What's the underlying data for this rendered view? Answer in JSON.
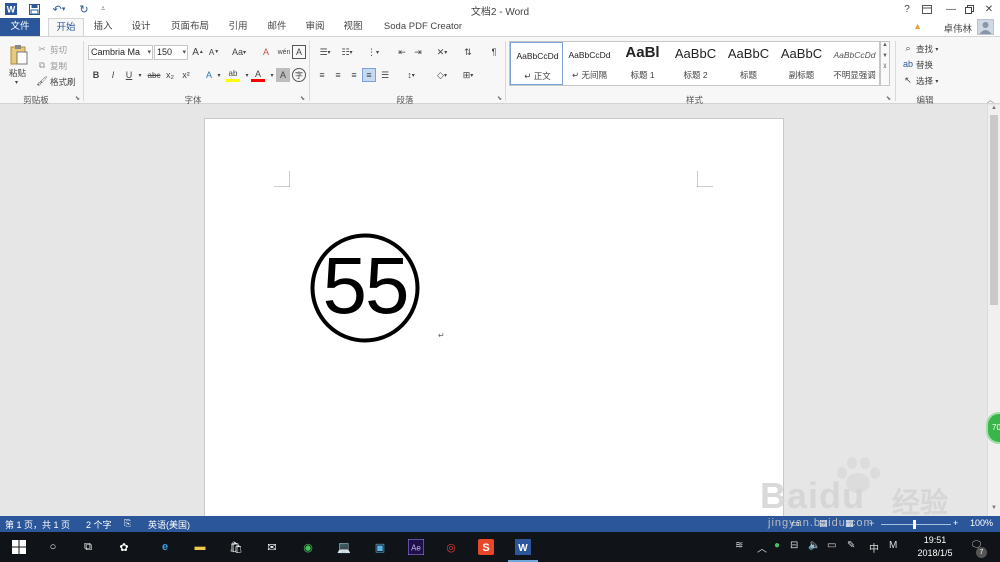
{
  "app": {
    "title": "文档2 - Word",
    "help": "?",
    "user_name": "卓伟林"
  },
  "tabs": [
    "文件",
    "开始",
    "插入",
    "设计",
    "页面布局",
    "引用",
    "邮件",
    "审阅",
    "视图",
    "Soda PDF Creator"
  ],
  "clipboard": {
    "paste": "粘贴",
    "cut": "剪切",
    "copy": "复制",
    "format_painter": "格式刷",
    "label": "剪贴板"
  },
  "font": {
    "name": "Cambria Ma",
    "size": "150",
    "label": "字体",
    "buttons": [
      "B",
      "I",
      "U",
      "abc",
      "x₂",
      "x²"
    ],
    "grow": "A",
    "shrink": "A",
    "case": "Aa",
    "clear_format": "A",
    "phonetic": "wén",
    "border_char": "A",
    "effects": "A",
    "highlight": "ab",
    "font_color": "A",
    "shading": "A",
    "enclose_char": "字"
  },
  "paragraph": {
    "label": "段落"
  },
  "styles": {
    "label": "样式",
    "items": [
      {
        "sample": "AaBbCcDd",
        "name": "↵ 正文"
      },
      {
        "sample": "AaBbCcDd",
        "name": "↵ 无间隔"
      },
      {
        "sample": "AaBl",
        "name": "标题 1"
      },
      {
        "sample": "AaBbC",
        "name": "标题 2"
      },
      {
        "sample": "AaBbC",
        "name": "标题"
      },
      {
        "sample": "AaBbC",
        "name": "副标题"
      },
      {
        "sample": "AaBbCcDd",
        "name": "不明显强调"
      }
    ]
  },
  "editing": {
    "find": "查找",
    "replace": "替换",
    "select": "选择",
    "label": "编辑"
  },
  "document": {
    "enclosed_number": "55",
    "paragraph_mark": "↵"
  },
  "statusbar": {
    "page": "第 1 页，共 1 页",
    "words": "2 个字",
    "language": "英语(美国)",
    "zoom": "100%"
  },
  "taskbar": {
    "tray_lang": "中",
    "tray_m": "M",
    "time": "19:51",
    "date": "2018/1/5",
    "notification_count": "7"
  },
  "floating_badge": "70",
  "watermark": {
    "brand": "Baidu",
    "cn": "经验",
    "url": "jingyan.baidu.com"
  },
  "colors": {
    "accent": "#2b579a",
    "highlight_yellow": "#ffff00",
    "font_red": "#ff0000",
    "taskbar": "#101317"
  }
}
